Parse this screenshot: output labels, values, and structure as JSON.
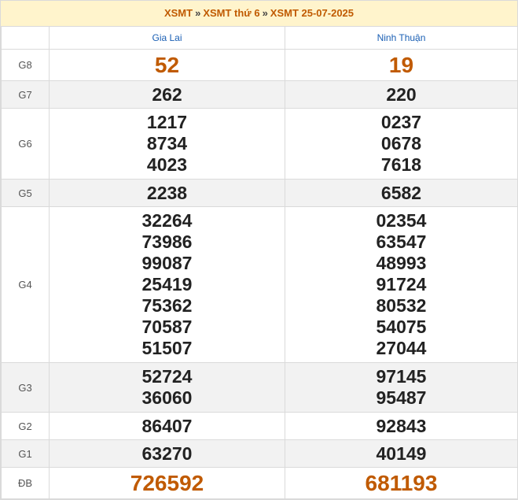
{
  "breadcrumb": {
    "item1": "XSMT",
    "item2": "XSMT thứ 6",
    "item3": "XSMT 25-07-2025",
    "separator": "»"
  },
  "columns": [
    "Gia Lai",
    "Ninh Thuận"
  ],
  "prizes": [
    {
      "label": "G8",
      "gia_lai": [
        "52"
      ],
      "ninh_thuan": [
        "19"
      ]
    },
    {
      "label": "G7",
      "gia_lai": [
        "262"
      ],
      "ninh_thuan": [
        "220"
      ]
    },
    {
      "label": "G6",
      "gia_lai": [
        "1217",
        "8734",
        "4023"
      ],
      "ninh_thuan": [
        "0237",
        "0678",
        "7618"
      ]
    },
    {
      "label": "G5",
      "gia_lai": [
        "2238"
      ],
      "ninh_thuan": [
        "6582"
      ]
    },
    {
      "label": "G4",
      "gia_lai": [
        "32264",
        "73986",
        "99087",
        "25419",
        "75362",
        "70587",
        "51507"
      ],
      "ninh_thuan": [
        "02354",
        "63547",
        "48993",
        "91724",
        "80532",
        "54075",
        "27044"
      ]
    },
    {
      "label": "G3",
      "gia_lai": [
        "52724",
        "36060"
      ],
      "ninh_thuan": [
        "97145",
        "95487"
      ]
    },
    {
      "label": "G2",
      "gia_lai": [
        "86407"
      ],
      "ninh_thuan": [
        "92843"
      ]
    },
    {
      "label": "G1",
      "gia_lai": [
        "63270"
      ],
      "ninh_thuan": [
        "40149"
      ]
    },
    {
      "label": "ĐB",
      "gia_lai": [
        "726592"
      ],
      "ninh_thuan": [
        "681193"
      ]
    }
  ],
  "colors": {
    "accent": "#c05a00",
    "header_link": "#1a5fb4",
    "breadcrumb_bg": "#fff4cc",
    "alt_row_bg": "#f2f2f2"
  }
}
